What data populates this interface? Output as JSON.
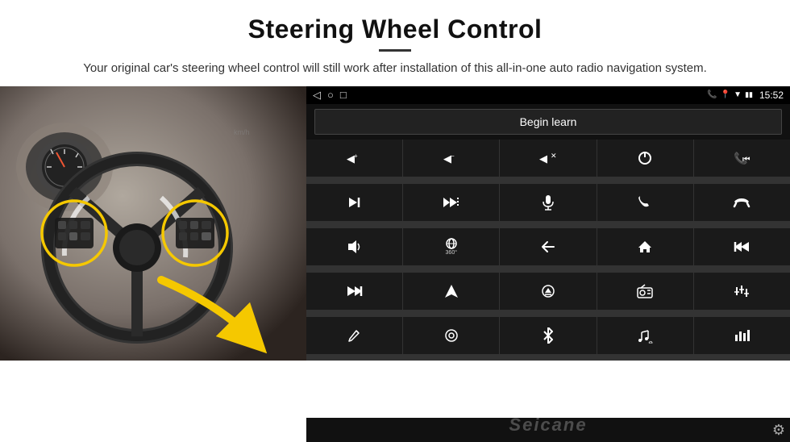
{
  "header": {
    "title": "Steering Wheel Control",
    "subtitle": "Your original car's steering wheel control will still work after installation of this all-in-one auto radio navigation system."
  },
  "status_bar": {
    "time": "15:52",
    "nav_icons": [
      "◁",
      "○",
      "□"
    ]
  },
  "begin_learn": {
    "label": "Begin learn"
  },
  "controls": [
    {
      "icon": "🔊+",
      "name": "vol-up"
    },
    {
      "icon": "🔊−",
      "name": "vol-down"
    },
    {
      "icon": "🔇",
      "name": "mute"
    },
    {
      "icon": "⏻",
      "name": "power"
    },
    {
      "icon": "⏭",
      "name": "prev-track"
    },
    {
      "icon": "⏭",
      "name": "next"
    },
    {
      "icon": "⏩",
      "name": "fast-forward"
    },
    {
      "icon": "🎙",
      "name": "mic"
    },
    {
      "icon": "📞",
      "name": "call"
    },
    {
      "icon": "↩",
      "name": "hang-up"
    },
    {
      "icon": "📢",
      "name": "horn"
    },
    {
      "icon": "360",
      "name": "360-cam"
    },
    {
      "icon": "↩",
      "name": "back"
    },
    {
      "icon": "⌂",
      "name": "home"
    },
    {
      "icon": "⏮",
      "name": "rewind"
    },
    {
      "icon": "⏭",
      "name": "skip-next"
    },
    {
      "icon": "▶",
      "name": "navigate"
    },
    {
      "icon": "⏏",
      "name": "eject"
    },
    {
      "icon": "📻",
      "name": "radio"
    },
    {
      "icon": "⚙",
      "name": "eq"
    },
    {
      "icon": "✏",
      "name": "edit"
    },
    {
      "icon": "⚙",
      "name": "settings-circle"
    },
    {
      "icon": "✶",
      "name": "bluetooth"
    },
    {
      "icon": "♪",
      "name": "music"
    },
    {
      "icon": "≡",
      "name": "menu"
    }
  ],
  "watermark": {
    "text": "Seicane"
  },
  "gear_icon_label": "⚙"
}
